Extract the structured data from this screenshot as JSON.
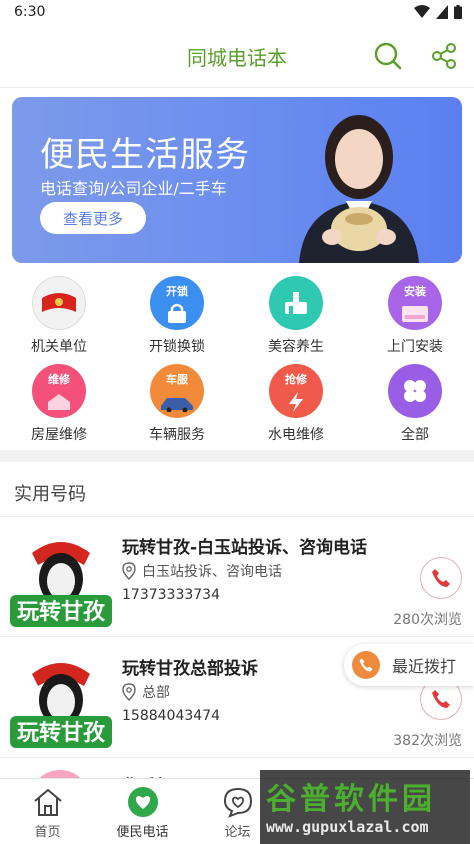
{
  "status_bar": {
    "time": "6:30"
  },
  "header": {
    "title": "同城电话本",
    "search_icon": "search-icon",
    "share_icon": "share-icon",
    "accent": "#5a9f2a"
  },
  "banner": {
    "title": "便民生活服务",
    "subtitle": "电话查询/公司企业/二手车",
    "button": "查看更多"
  },
  "categories": [
    {
      "label": "机关单位",
      "icon": "government-icon",
      "chip": ""
    },
    {
      "label": "开锁换锁",
      "icon": "lock-icon",
      "chip": "开锁"
    },
    {
      "label": "美容养生",
      "icon": "beauty-icon",
      "chip": ""
    },
    {
      "label": "上门安装",
      "icon": "install-icon",
      "chip": "安装"
    },
    {
      "label": "房屋维修",
      "icon": "house-repair-icon",
      "chip": "维修"
    },
    {
      "label": "车辆服务",
      "icon": "car-icon",
      "chip": "车服"
    },
    {
      "label": "水电维修",
      "icon": "plumbing-electric-icon",
      "chip": "抢修"
    },
    {
      "label": "全部",
      "icon": "all-icon",
      "chip": ""
    }
  ],
  "section": {
    "title": "实用号码"
  },
  "listings": [
    {
      "title": "玩转甘孜-白玉站投诉、咨询电话",
      "address": "白玉站投诉、咨询电话",
      "phone": "17373333734",
      "views": "280次浏览",
      "logo_text": "玩转甘孜"
    },
    {
      "title": "玩转甘孜总部投诉",
      "address": "总部",
      "phone": "15884043474",
      "views": "382次浏览",
      "logo_text": "玩转甘孜"
    }
  ],
  "partial_item": {
    "text": "华丢机"
  },
  "recent_call": {
    "label": "最近拨打"
  },
  "bottom_nav": [
    {
      "label": "首页",
      "icon": "home-icon"
    },
    {
      "label": "便民电话",
      "icon": "phone-heart-icon"
    },
    {
      "label": "论坛",
      "icon": "forum-heart-icon"
    }
  ],
  "watermark": {
    "title": "谷普软件园",
    "url": "www.gupuxlazal.com"
  }
}
